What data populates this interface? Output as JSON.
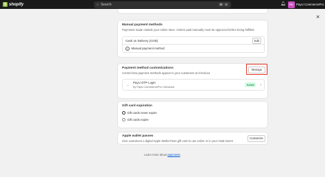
{
  "topbar": {
    "brand": "shopify",
    "search_placeholder": "Search",
    "shortcut": [
      "⌘",
      "K"
    ],
    "store_initials": "PC",
    "store_name": "PayU CommercePro"
  },
  "manual": {
    "title": "Manual payment methods",
    "desc": "Payments made outside your online store. Orders paid manually must be approved before being fulfilled.",
    "method": "Cash on Delivery (COD)",
    "edit_label": "Edit",
    "add_label": "Manual payment method"
  },
  "custom": {
    "title": "Payment method customizations",
    "desc": "Control how payment methods appear to your customers at checkout",
    "manage_label": "Manage",
    "gateway_name": "PayU OTP Login",
    "gateway_by": "by PayU CommercePro Checkout",
    "status": "Active"
  },
  "gift": {
    "title": "Gift card expiration",
    "options": [
      "Gift cards never expire",
      "Gift cards expire"
    ],
    "selected": 0
  },
  "apple": {
    "title": "Apple wallet passes",
    "desc": "Give customers a digital Apple Wallet Pass gift card to use online or in your retail stores",
    "customize_label": "Customize"
  },
  "footer": {
    "text": "Learn more about",
    "link": "payments",
    "end": "."
  }
}
